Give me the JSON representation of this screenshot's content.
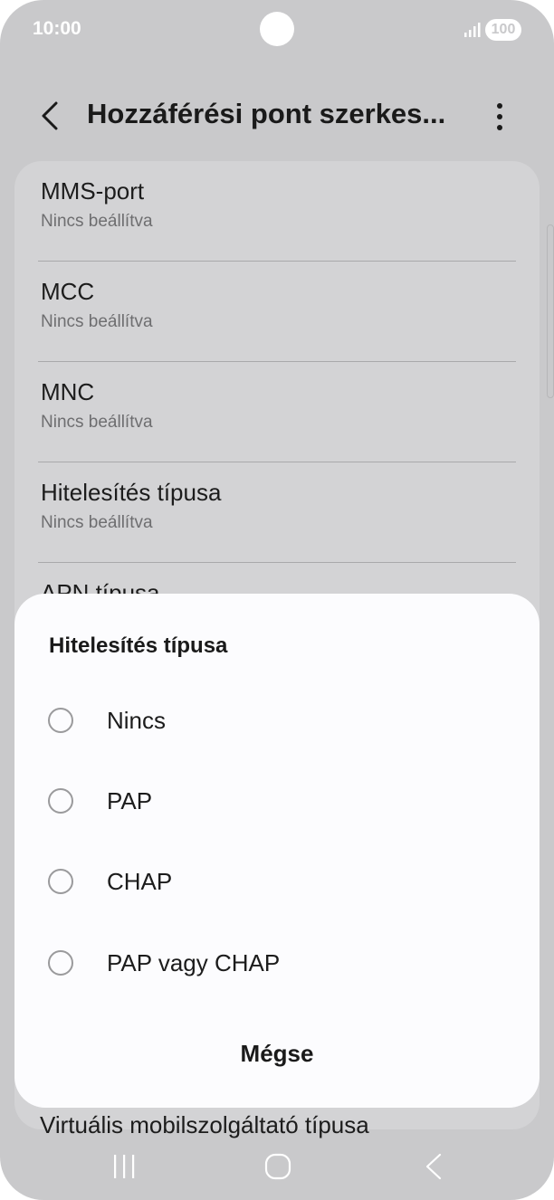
{
  "status_bar": {
    "time": "10:00",
    "battery": "100",
    "signal_icon": "signal-icon"
  },
  "header": {
    "title": "Hozzáférési pont szerkes...",
    "back_icon": "chevron-left-icon",
    "more_icon": "more-vertical-icon"
  },
  "list": {
    "items": [
      {
        "title": "MMS-port",
        "value": "Nincs beállítva"
      },
      {
        "title": "MCC",
        "value": "Nincs beállítva"
      },
      {
        "title": "MNC",
        "value": "Nincs beállítva"
      },
      {
        "title": "Hitelesítés típusa",
        "value": "Nincs beállítva"
      },
      {
        "title": "APN típusa"
      }
    ],
    "bottom_peek": "Virtuális mobilszolgáltató típusa"
  },
  "dialog": {
    "title": "Hitelesítés típusa",
    "options": [
      {
        "label": "Nincs"
      },
      {
        "label": "PAP"
      },
      {
        "label": "CHAP"
      },
      {
        "label": "PAP vagy CHAP"
      }
    ],
    "cancel_label": "Mégse"
  },
  "nav_bar": {
    "icons": [
      "recent-apps-icon",
      "home-icon",
      "back-icon"
    ]
  },
  "colors": {
    "dim_background": "#c9c9cb",
    "card": "#d3d3d5",
    "dialog": "#fcfcfe"
  }
}
